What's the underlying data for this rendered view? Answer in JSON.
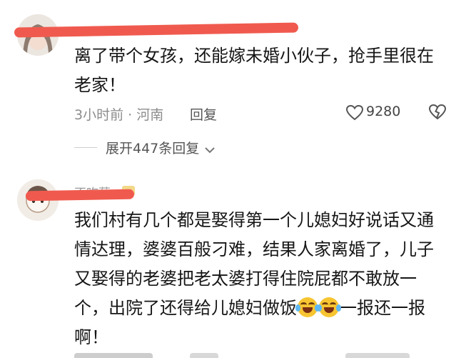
{
  "comments": [
    {
      "avatar_icon": "user-avatar-icon",
      "text_lines": [
        "离了带个女孩，还能嫁未婚小伙子，抢手里很在",
        "老家！"
      ],
      "time": "3小时前 · 河南",
      "reply_label": "回复",
      "likes": "9280",
      "replies_expand": "展开447条回复"
    },
    {
      "avatar_icon": "user-avatar-icon",
      "username": "不吃葱",
      "text_lines": [
        "我们村有几个都是娶得第一个儿媳妇好说话又通",
        "情达理，婆婆百般刁难，结果人家离婚了，儿子",
        "又娶得的老婆把老太婆打得住院屁都不敢放一"
      ],
      "line4_before": "个，出院了还得给儿媳妇做饭",
      "line4_after": "一报还一报",
      "line5": "啊！"
    }
  ],
  "colors": {
    "redact": "#f05a4e",
    "meta": "#8c8c8c"
  }
}
